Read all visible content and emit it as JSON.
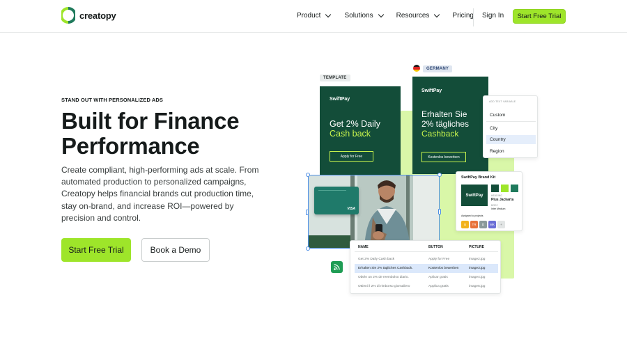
{
  "header": {
    "logo_text": "creatopy",
    "nav": [
      {
        "label": "Product",
        "has_dropdown": true
      },
      {
        "label": "Solutions",
        "has_dropdown": true
      },
      {
        "label": "Resources",
        "has_dropdown": true
      },
      {
        "label": "Pricing",
        "has_dropdown": false
      }
    ],
    "sign_in": "Sign In",
    "cta": "Start Free Trial"
  },
  "hero": {
    "eyebrow": "STAND OUT WITH PERSONALIZED ADS",
    "headline_line1": "Built for Finance",
    "headline_line2": "Performance",
    "description": "Create compliant, high-performing ads at scale. From automated production to personalized campaigns, Creatopy helps financial brands cut production time, stay on-brand, and increase ROI—powered by precision and control.",
    "primary_button": "Start Free Trial",
    "secondary_button": "Book a Demo"
  },
  "illustration": {
    "template_tag": "TEMPLATE",
    "germany_tag": "GERMANY",
    "card_template": {
      "brand": "SwiftPay",
      "headline_line1": "Get 2% Daily",
      "headline_line2": "Cash back",
      "button": "Apply for Free"
    },
    "card_germany": {
      "brand": "SwiftPay",
      "headline_line1": "Erhalten Sie",
      "headline_line2": "2% tägliches",
      "headline_line3": "Cashback",
      "button": "Kostenlos bewerben"
    },
    "variable_panel": {
      "title": "ADD TEXT VARIABLE",
      "items": [
        "Custom",
        "City",
        "Country",
        "Region"
      ],
      "active": "Country"
    },
    "photo_card": {
      "brand": "SwiftPay",
      "card_network": "VISA"
    },
    "brand_kit": {
      "title": "SwiftPay Brand Kit",
      "logo": "SwiftPay",
      "heading_label": "HEADING",
      "heading_font": "Plus Jackarta",
      "body_label": "BODY",
      "body_font": "Inter Medium",
      "assigned_label": "Assigned to projects",
      "colors": [
        "#134d39",
        "#9ee52a",
        "#1f7a5c"
      ],
      "projects": [
        {
          "label": "U",
          "color": "#f2b21b"
        },
        {
          "label": "TR",
          "color": "#e8733a"
        },
        {
          "label": "D",
          "color": "#8a9a9a"
        },
        {
          "label": "MK",
          "color": "#6b6fd6"
        },
        {
          "label": "+",
          "color": "#e2e5e5"
        }
      ]
    },
    "table": {
      "columns": [
        "NAME",
        "BUTTON",
        "PICTURE"
      ],
      "rows": [
        {
          "name": "Get 2% Daily Cash back",
          "button": "Apply for Free",
          "picture": "image2.jpg",
          "active": false
        },
        {
          "name": "Erhalten Sie 2% tägliches Cashback.",
          "button": "Kostenlos bewerben",
          "picture": "image3.jpg",
          "active": true
        },
        {
          "name": "Obtén un 2% de reembolso diario.",
          "button": "Aplicar gratis",
          "picture": "image4.jpg",
          "active": false
        },
        {
          "name": "Ottieni il 2% di rimborso giornaliero",
          "button": "Applica gratis",
          "picture": "image5.jpg",
          "active": false
        }
      ]
    }
  }
}
